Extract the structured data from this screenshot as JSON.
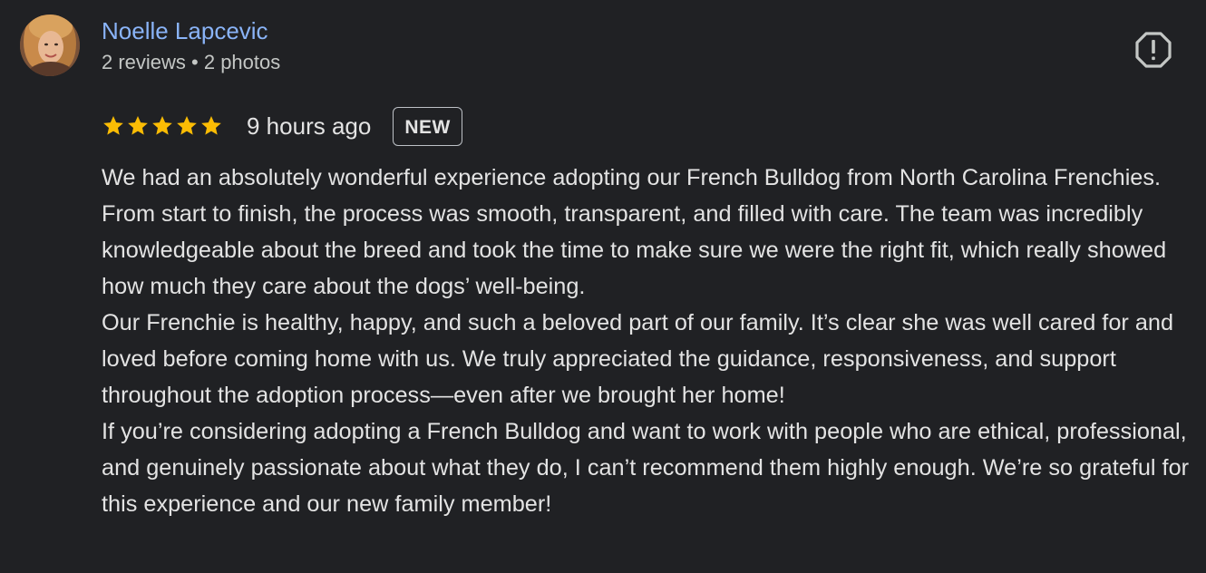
{
  "reviewer": {
    "name": "Noelle Lapcevic",
    "meta": "2 reviews • 2 photos"
  },
  "rating": {
    "stars": 5,
    "max": 5,
    "star_color": "#fbbc04",
    "time_ago": "9 hours ago",
    "badge": "NEW"
  },
  "review": {
    "paragraphs": [
      "We had an absolutely wonderful experience adopting our French Bulldog from North Carolina Frenchies. From start to finish, the process was smooth, transparent, and filled with care. The team was incredibly knowledgeable about the breed and took the time to make sure we were the right fit, which really showed how much they care about the dogs’ well-being.",
      "Our Frenchie is healthy, happy, and such a beloved part of our family. It’s clear she was well cared for and loved before coming home with us. We truly appreciated the guidance, responsiveness, and support throughout the adoption process—even after we brought her home!",
      "If you’re considering adopting a French Bulldog and want to work with people who are ethical, professional, and genuinely passionate about what they do, I can’t recommend them highly enough. We’re so grateful for this experience and our new family member!"
    ]
  },
  "icons": {
    "report": "report-octagon-icon",
    "avatar": "profile-photo"
  },
  "colors": {
    "background": "#202124",
    "name": "#8ab4f8",
    "text": "#e3e3e3",
    "secondary": "#c4c7c5"
  }
}
